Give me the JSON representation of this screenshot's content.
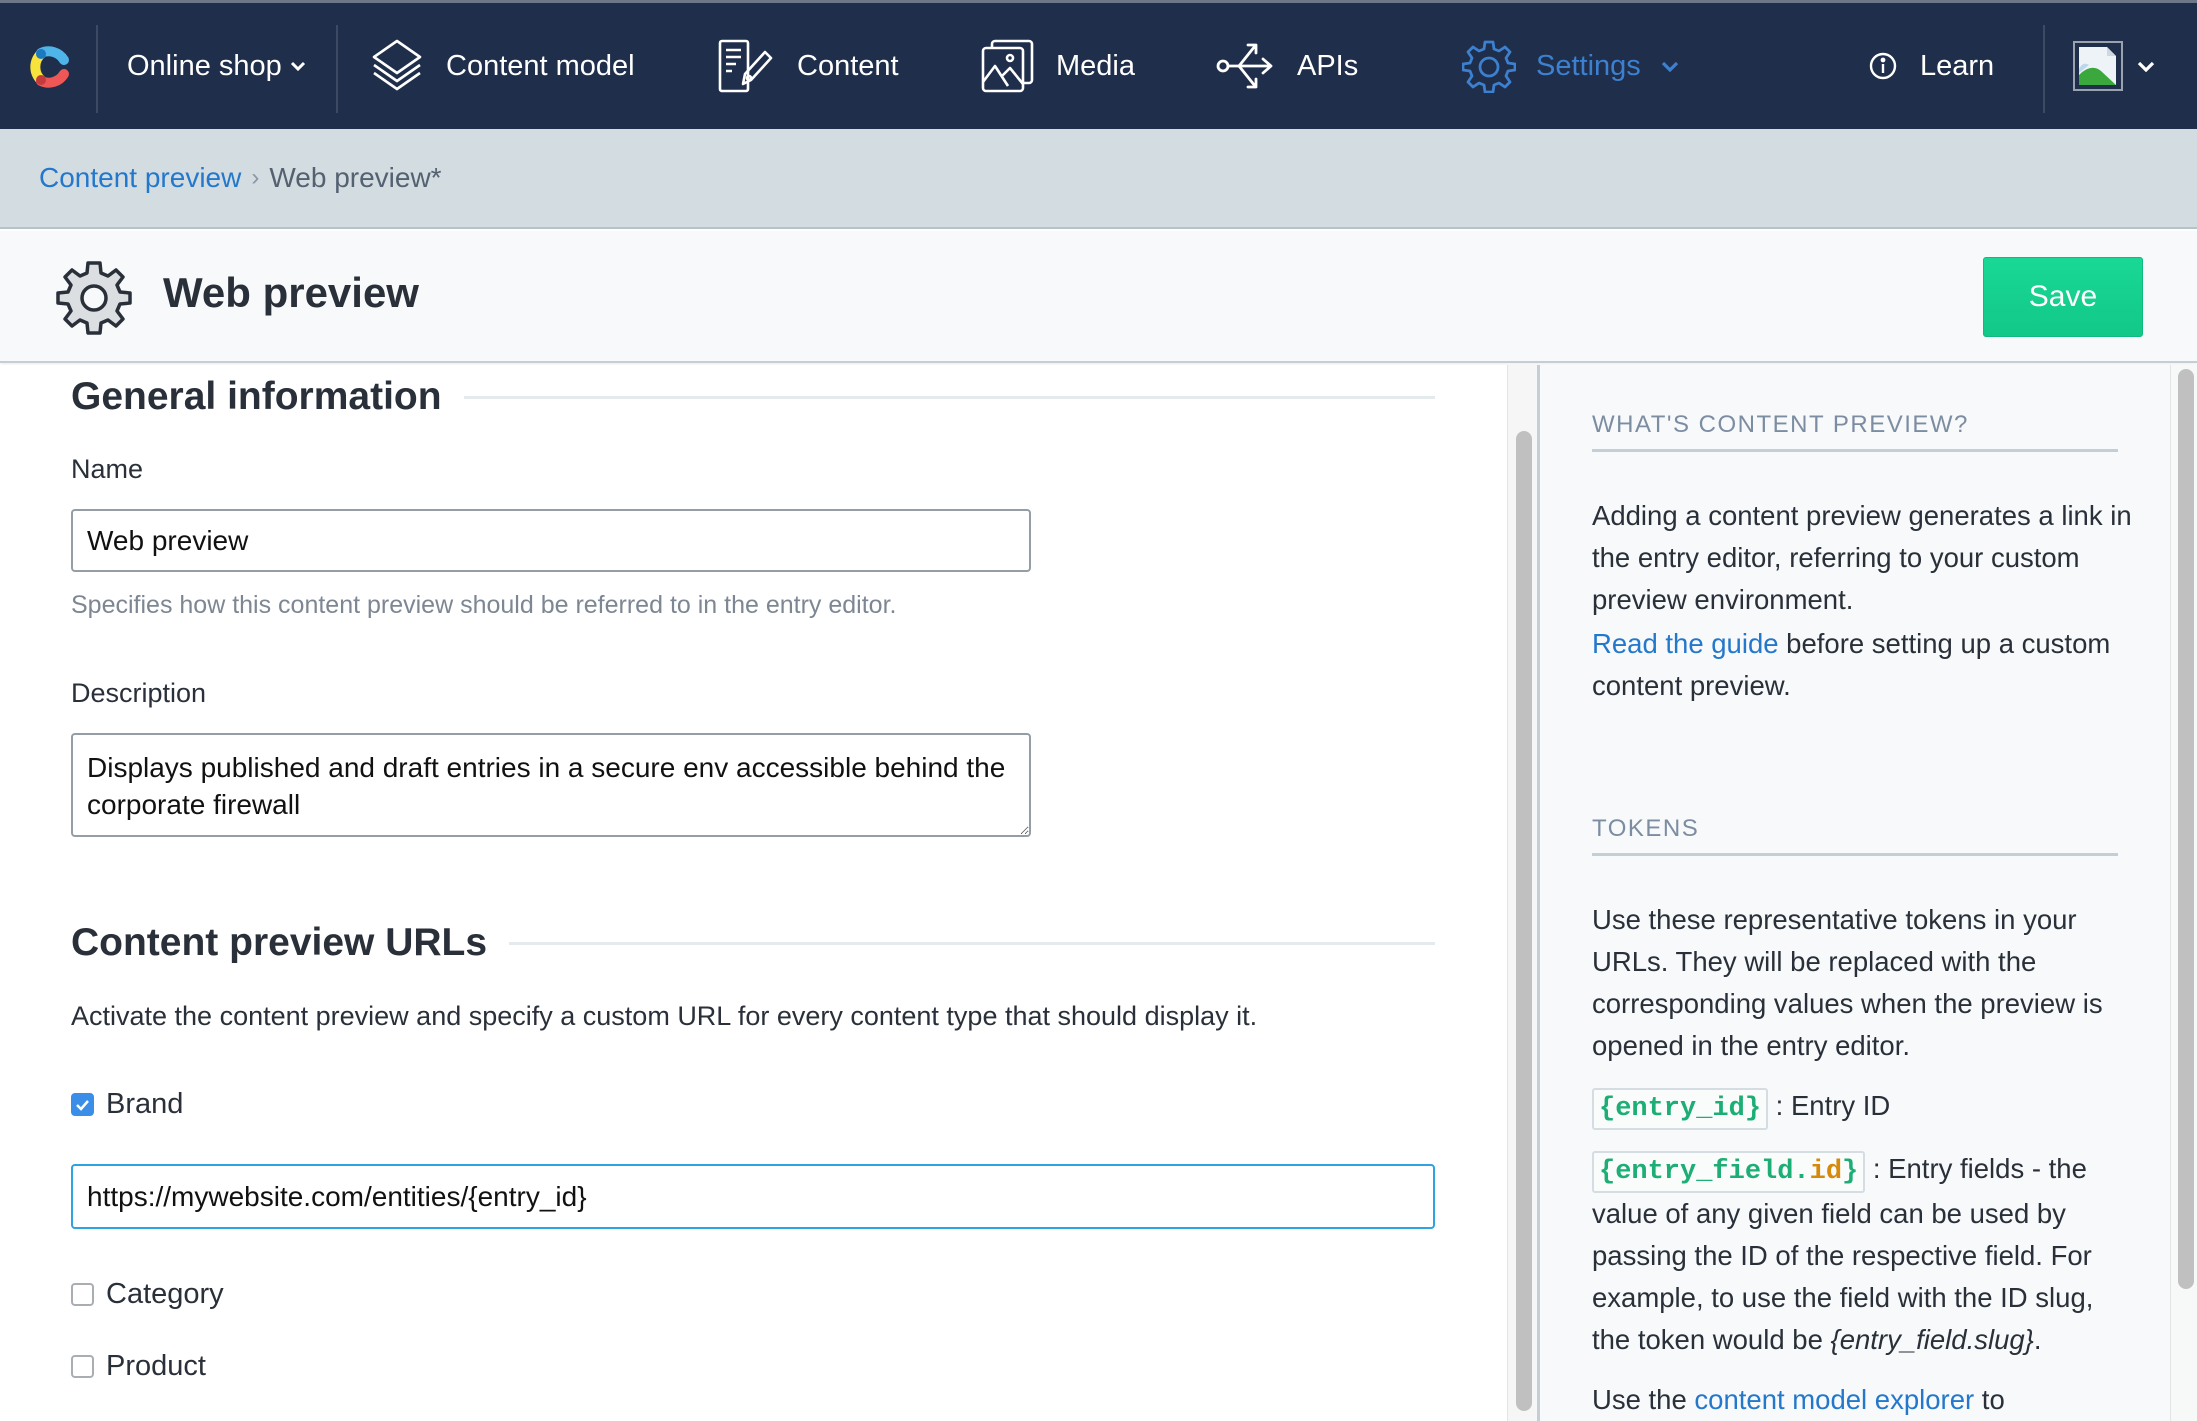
{
  "nav": {
    "space_name": "Online shop",
    "items": [
      {
        "label": "Content model",
        "icon": "layers-icon"
      },
      {
        "label": "Content",
        "icon": "content-edit-icon"
      },
      {
        "label": "Media",
        "icon": "media-icon"
      },
      {
        "label": "APIs",
        "icon": "api-icon"
      },
      {
        "label": "Settings",
        "icon": "gear-icon",
        "active": true
      },
      {
        "label": "Learn",
        "icon": "info-icon"
      }
    ],
    "colors": {
      "bg": "#1f2e4a",
      "active": "#3c80cf"
    }
  },
  "breadcrumb": {
    "parent": "Content preview",
    "separator": "›",
    "current": "Web preview*"
  },
  "header": {
    "title": "Web preview",
    "save_label": "Save",
    "save_color": "#17d18f"
  },
  "main": {
    "general": {
      "heading": "General information",
      "name_label": "Name",
      "name_value": "Web preview",
      "name_hint": "Specifies how this content preview should be referred to in the entry editor.",
      "description_label": "Description",
      "description_value": "Displays published and draft entries in a secure env accessible behind the corporate firewall"
    },
    "urls": {
      "heading": "Content preview URLs",
      "intro": "Activate the content preview and specify a custom URL for every content type that should display it.",
      "content_types": [
        {
          "label": "Brand",
          "checked": true,
          "url": "https://mywebsite.com/entities/{entry_id}"
        },
        {
          "label": "Category",
          "checked": false
        },
        {
          "label": "Product",
          "checked": false
        }
      ]
    }
  },
  "sidebar": {
    "what_heading": "WHAT'S CONTENT PREVIEW?",
    "what_text": "Adding a content preview generates a link in the entry editor, referring to your custom preview environment.",
    "guide_link": "Read the guide",
    "guide_rest": " before setting up a custom content preview.",
    "tokens_heading": "TOKENS",
    "tokens_intro": "Use these representative tokens in your URLs. They will be replaced with the corresponding values when the preview is opened in the entry editor.",
    "token1": "{entry_id}",
    "token1_desc": " : Entry ID",
    "token2_prefix": "{entry_field.",
    "token2_highlight": "id",
    "token2_suffix": "}",
    "token2_desc": " : Entry fields - the value of any given field can be used by passing the ID of the respective field. For example, to use the field with the ID slug, the token would be ",
    "token2_example": "{entry_field.slug}",
    "token2_end": ".",
    "explorer_pre": "Use the ",
    "explorer_link": "content model explorer",
    "explorer_post": " to"
  }
}
